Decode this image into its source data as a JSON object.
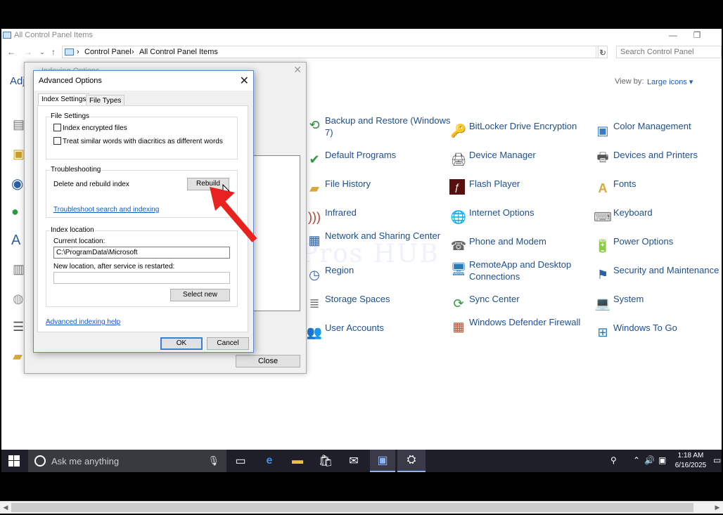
{
  "explorer": {
    "title": "All Control Panel Items",
    "breadcrumb": [
      "Control Panel",
      "All Control Panel Items"
    ],
    "search_placeholder": "Search Control Panel",
    "adjust_text": "Adj",
    "view_by_label": "View by:",
    "view_by_value": "Large icons",
    "items": [
      {
        "label": "Backup and Restore (Windows 7)",
        "icon": "backup-icon"
      },
      {
        "label": "Default Programs",
        "icon": "default-programs-icon"
      },
      {
        "label": "File History",
        "icon": "file-history-icon"
      },
      {
        "label": "Infrared",
        "icon": "infrared-icon"
      },
      {
        "label": "Network and Sharing Center",
        "icon": "network-icon"
      },
      {
        "label": "Region",
        "icon": "region-icon"
      },
      {
        "label": "Storage Spaces",
        "icon": "storage-icon"
      },
      {
        "label": "User Accounts",
        "icon": "user-accounts-icon"
      },
      {
        "label": "BitLocker Drive Encryption",
        "icon": "bitlocker-icon"
      },
      {
        "label": "Device Manager",
        "icon": "device-manager-icon"
      },
      {
        "label": "Flash Player",
        "icon": "flash-icon"
      },
      {
        "label": "Internet Options",
        "icon": "internet-options-icon"
      },
      {
        "label": "Phone and Modem",
        "icon": "phone-icon"
      },
      {
        "label": "RemoteApp and Desktop Connections",
        "icon": "remoteapp-icon"
      },
      {
        "label": "Sync Center",
        "icon": "sync-icon"
      },
      {
        "label": "Windows Defender Firewall",
        "icon": "firewall-icon"
      },
      {
        "label": "Color Management",
        "icon": "color-management-icon"
      },
      {
        "label": "Devices and Printers",
        "icon": "printer-icon"
      },
      {
        "label": "Fonts",
        "icon": "fonts-icon"
      },
      {
        "label": "Keyboard",
        "icon": "keyboard-icon"
      },
      {
        "label": "Power Options",
        "icon": "power-icon"
      },
      {
        "label": "Security and Maintenance",
        "icon": "flag-icon"
      },
      {
        "label": "System",
        "icon": "system-icon"
      },
      {
        "label": "Windows To Go",
        "icon": "windows-to-go-icon"
      }
    ]
  },
  "watermark": "IT Pros HUB",
  "indexing_window": {
    "title": "Indexing Options",
    "close_label": "Close"
  },
  "advanced": {
    "title": "Advanced Options",
    "tabs": [
      "Index Settings",
      "File Types"
    ],
    "file_settings": {
      "title": "File Settings",
      "options": [
        "Index encrypted files",
        "Treat similar words with diacritics as different words"
      ]
    },
    "troubleshooting": {
      "title": "Troubleshooting",
      "delete_label": "Delete and rebuild index",
      "rebuild_button": "Rebuild",
      "troubleshoot_link": "Troubleshoot search and indexing"
    },
    "index_location": {
      "title": "Index location",
      "current_label": "Current location:",
      "current_value": "C:\\ProgramData\\Microsoft",
      "new_label": "New location, after service is restarted:",
      "new_value": "",
      "select_new_button": "Select new"
    },
    "help_link": "Advanced indexing help",
    "ok_button": "OK",
    "cancel_button": "Cancel"
  },
  "annotation_arrow_color": "#e8231f",
  "taskbar": {
    "search_placeholder": "Ask me anything",
    "clock_time": "1:18 AM",
    "clock_date": "6/16/2025"
  }
}
